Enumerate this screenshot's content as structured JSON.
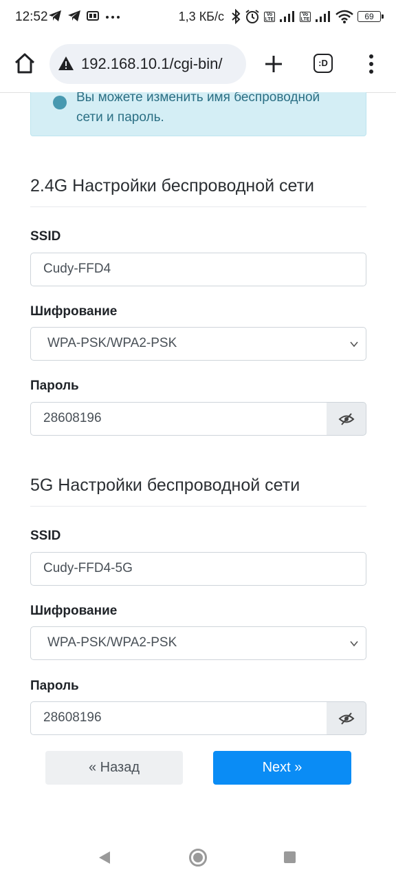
{
  "status_bar": {
    "time": "12:52",
    "speed": "1,3 КБ/с",
    "battery": "69"
  },
  "browser": {
    "url": "192.168.10.1/cgi-bin/",
    "tabs_label": ":D"
  },
  "alert": {
    "line1": "Вы можете изменить имя беспроводной",
    "line2": "сети и пароль."
  },
  "wifi_24g": {
    "title": "2.4G Настройки беспроводной сети",
    "ssid_label": "SSID",
    "ssid_value": "Cudy-FFD4",
    "encryption_label": "Шифрование",
    "encryption_value": "WPA-PSK/WPA2-PSK",
    "password_label": "Пароль",
    "password_value": "28608196"
  },
  "wifi_5g": {
    "title": "5G Настройки беспроводной сети",
    "ssid_label": "SSID",
    "ssid_value": "Cudy-FFD4-5G",
    "encryption_label": "Шифрование",
    "encryption_value": "WPA-PSK/WPA2-PSK",
    "password_label": "Пароль",
    "password_value": "28608196"
  },
  "buttons": {
    "back": "« Назад",
    "next": "Next »"
  },
  "colors": {
    "primary": "#0a8cf5",
    "alert_bg": "#d4eef5",
    "alert_text": "#2b6f84"
  }
}
